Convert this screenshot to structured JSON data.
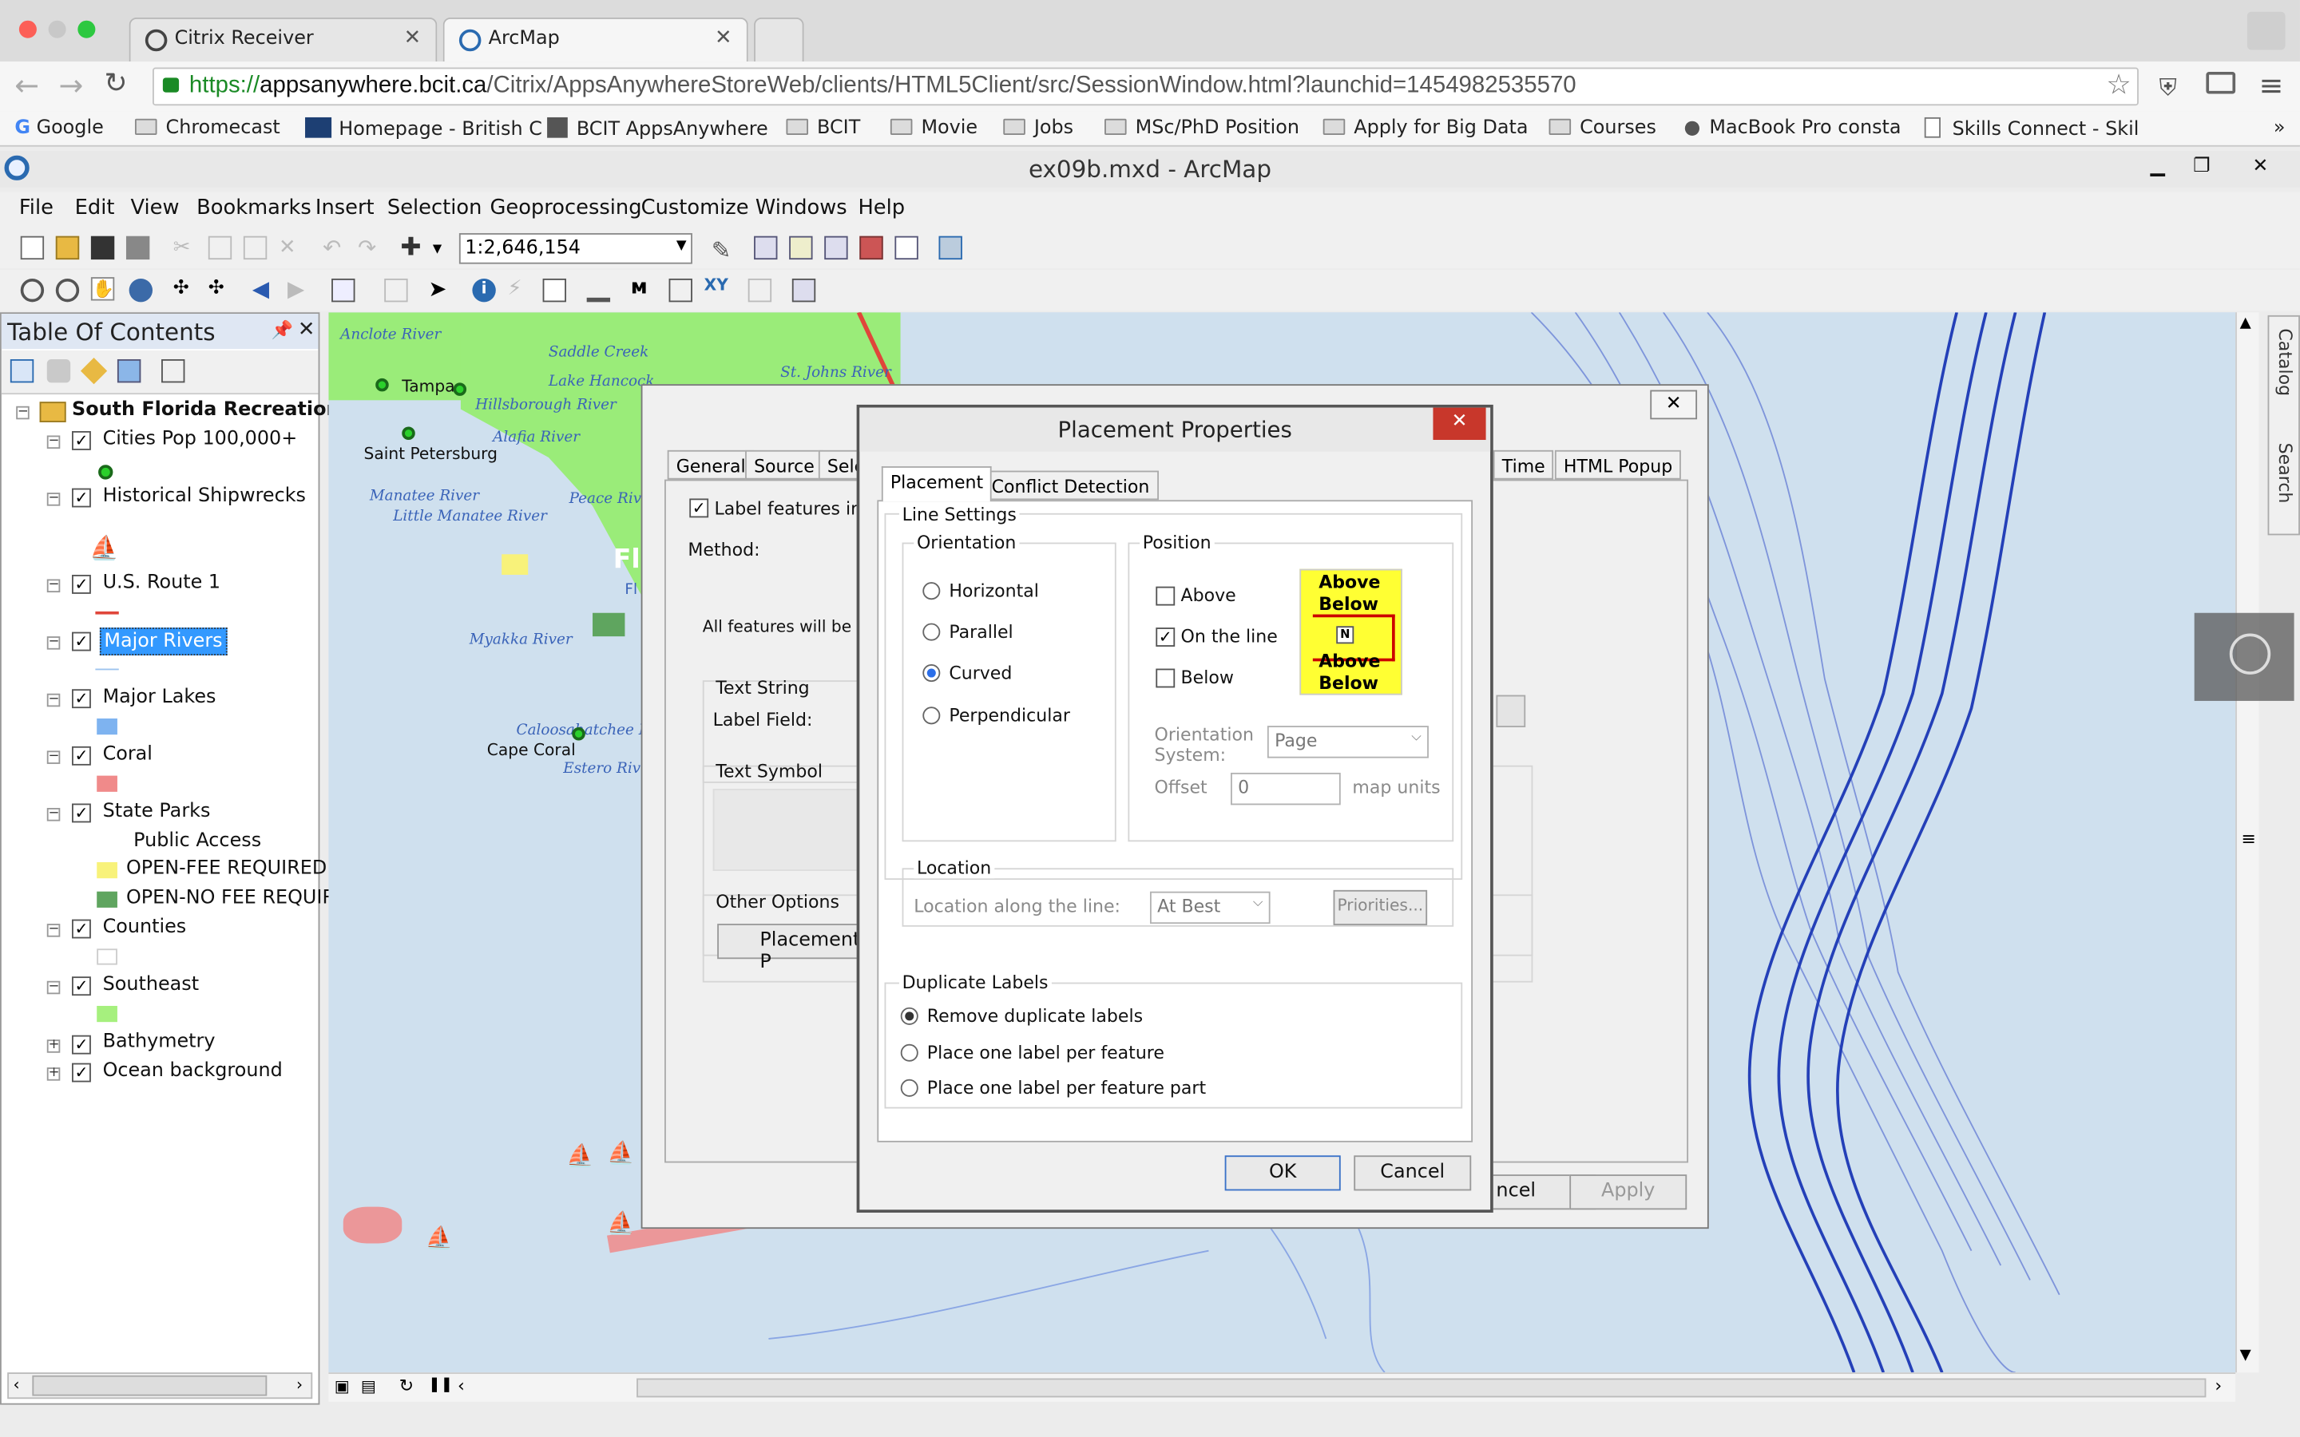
{
  "browser": {
    "tabs": [
      {
        "label": "Citrix Receiver"
      },
      {
        "label": "ArcMap"
      }
    ],
    "url_scheme": "https://",
    "url_host": "appsanywhere.bcit.ca",
    "url_path": "/Citrix/AppsAnywhereStoreWeb/clients/HTML5Client/src/SessionWindow.html?launchid=1454982535570",
    "bookmarks": [
      "Google",
      "Chromecast",
      "Homepage - British C",
      "BCIT AppsAnywhere",
      "BCIT",
      "Movie",
      "Jobs",
      "MSc/PhD Position",
      "Apply for Big Data",
      "Courses",
      "MacBook Pro consta",
      "Skills Connect - Skil"
    ],
    "more": "»"
  },
  "arcmap": {
    "title": "ex09b.mxd - ArcMap",
    "menus": [
      "File",
      "Edit",
      "View",
      "Bookmarks",
      "Insert",
      "Selection",
      "Geoprocessing",
      "Customize",
      "Windows",
      "Help"
    ],
    "scale": "1:2,646,154"
  },
  "toc": {
    "title": "Table Of Contents",
    "root": "South Florida Recreation",
    "layers": [
      {
        "name": "Cities Pop 100,000+"
      },
      {
        "name": "Historical Shipwrecks"
      },
      {
        "name": "U.S. Route 1"
      },
      {
        "name": "Major Rivers"
      },
      {
        "name": "Major Lakes"
      },
      {
        "name": "Coral"
      },
      {
        "name": "State Parks"
      },
      {
        "name": "Counties"
      },
      {
        "name": "Southeast"
      },
      {
        "name": "Bathymetry"
      },
      {
        "name": "Ocean background"
      }
    ],
    "parks_field": "Public Access",
    "parks_classes": [
      "OPEN-FEE REQUIRED",
      "OPEN-NO FEE REQUIR"
    ],
    "colors": {
      "route": "#e0463a",
      "lakes": "#7eb3f0",
      "coral": "#f08a8a",
      "fee": "#f8f27a",
      "nofee": "#5fa55f",
      "southeast": "#a6f07e",
      "selected": "#3399ff"
    }
  },
  "map": {
    "places": [
      "Tampa",
      "Saint Petersburg",
      "Cape Coral"
    ],
    "rivers": [
      "Anclote River",
      "Hillsborough River",
      "Alafia River",
      "Manatee River",
      "Little Manatee River",
      "Peace River",
      "Myakka River",
      "Caloosahatchee R",
      "Estero River",
      "Saddle Creek",
      "Lake Hancock",
      "St. Johns River"
    ],
    "partial": [
      "Fl",
      "Fl"
    ]
  },
  "label_dialog": {
    "tabs": [
      "General",
      "Source",
      "Sele",
      "Time",
      "HTML Popup"
    ],
    "checkbox": "Label features in th",
    "method": "Method:",
    "all_features": "All features will be lab",
    "text_string": "Text String",
    "label_field": "Label Field:",
    "text_symbol": "Text Symbol",
    "other_options": "Other Options",
    "placement_btn": "Placement P",
    "cancel_btn": "ncel",
    "apply_btn": "Apply",
    "close": "✕"
  },
  "placement": {
    "title": "Placement Properties",
    "close": "✕",
    "tabs": [
      "Placement",
      "Conflict Detection"
    ],
    "line_settings": "Line Settings",
    "orientation": "Orientation",
    "orientation_options": [
      "Horizontal",
      "Parallel",
      "Curved",
      "Perpendicular"
    ],
    "orientation_selected": "Curved",
    "position": "Position",
    "position_options": [
      {
        "label": "Above",
        "checked": false
      },
      {
        "label": "On the line",
        "checked": true
      },
      {
        "label": "Below",
        "checked": false
      }
    ],
    "diagram_text": [
      "Above",
      "Below",
      "Above",
      "Below"
    ],
    "diagram_north": "N",
    "orientation_system_label": "Orientation\nSystem:",
    "orientation_system_value": "Page",
    "offset_label": "Offset",
    "offset_value": "0",
    "offset_unit": "map units",
    "location": "Location",
    "location_label": "Location along the line:",
    "location_value": "At Best",
    "priorities_btn": "Priorities...",
    "duplicate": "Duplicate Labels",
    "duplicate_options": [
      "Remove duplicate labels",
      "Place one label per feature",
      "Place one label per feature part"
    ],
    "duplicate_selected": "Remove duplicate labels",
    "ok": "OK",
    "cancel": "Cancel"
  },
  "side": {
    "catalog": "Catalog",
    "search": "Search"
  }
}
